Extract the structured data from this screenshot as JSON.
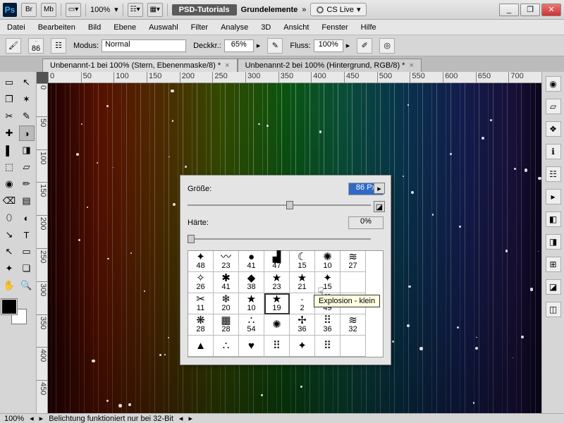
{
  "titlebar": {
    "zoom": "100%",
    "tutorials": "PSD-Tutorials",
    "workspace_name": "Grundelemente",
    "cs_live": "CS Live"
  },
  "window_controls": {
    "min": "_",
    "max": "❐",
    "close": "✕"
  },
  "menubar": [
    "Datei",
    "Bearbeiten",
    "Bild",
    "Ebene",
    "Auswahl",
    "Filter",
    "Analyse",
    "3D",
    "Ansicht",
    "Fenster",
    "Hilfe"
  ],
  "optionsbar": {
    "brush_size": "86",
    "mode_label": "Modus:",
    "mode_value": "Normal",
    "opacity_label": "Deckkr.:",
    "opacity_value": "65%",
    "flow_label": "Fluss:",
    "flow_value": "100%"
  },
  "doctabs": [
    "Unbenannt-1 bei 100% (Stern, Ebenenmaske/8) *",
    "Unbenannt-2 bei 100% (Hintergrund, RGB/8) *"
  ],
  "ruler_h": [
    "0",
    "50",
    "100",
    "150",
    "200",
    "250",
    "300",
    "350",
    "400",
    "450",
    "500",
    "550",
    "600",
    "650",
    "700"
  ],
  "ruler_v": [
    "0",
    "50",
    "100",
    "150",
    "200",
    "250",
    "300",
    "350",
    "400",
    "450"
  ],
  "brush_popup": {
    "size_label": "Größe:",
    "size_value": "86 Px",
    "hardness_label": "Härte:",
    "hardness_value": "0%",
    "flyout": "▸",
    "new_preset": "◪",
    "brushes": [
      {
        "n": "48",
        "g": "✦"
      },
      {
        "n": "23",
        "g": "〰"
      },
      {
        "n": "41",
        "g": "●"
      },
      {
        "n": "47",
        "g": "▟"
      },
      {
        "n": "15",
        "g": "☾"
      },
      {
        "n": "10",
        "g": "✺"
      },
      {
        "n": "27",
        "g": "≋"
      },
      {
        "n": "26",
        "g": "✧"
      },
      {
        "n": "41",
        "g": "✱"
      },
      {
        "n": "38",
        "g": "◆"
      },
      {
        "n": "23",
        "g": "★"
      },
      {
        "n": "21",
        "g": "★"
      },
      {
        "n": "15",
        "g": "✦"
      },
      {
        "n": "",
        "g": ""
      },
      {
        "n": "11",
        "g": "✂"
      },
      {
        "n": "20",
        "g": "❄"
      },
      {
        "n": "10",
        "g": "★"
      },
      {
        "n": "19",
        "g": "★"
      },
      {
        "n": "2",
        "g": "·"
      },
      {
        "n": "49",
        "g": "⠿"
      },
      {
        "n": "",
        "g": ""
      },
      {
        "n": "28",
        "g": "❋"
      },
      {
        "n": "28",
        "g": "▦"
      },
      {
        "n": "54",
        "g": "∴"
      },
      {
        "n": "",
        "g": "✺"
      },
      {
        "n": "36",
        "g": "✢"
      },
      {
        "n": "36",
        "g": "⠿"
      },
      {
        "n": "32",
        "g": "≋"
      },
      {
        "n": "",
        "g": "▲"
      },
      {
        "n": "",
        "g": "∴"
      },
      {
        "n": "",
        "g": "♥"
      },
      {
        "n": "",
        "g": "⠿"
      },
      {
        "n": "",
        "g": "✦"
      },
      {
        "n": "",
        "g": "⠿"
      },
      {
        "n": "",
        "g": ""
      }
    ],
    "tooltip": "Explosion - klein"
  },
  "statusbar": {
    "zoom": "100%",
    "msg": "Belichtung funktioniert nur bei 32-Bit"
  },
  "tool_glyphs": [
    "▭",
    "↖",
    "❐",
    "✶",
    "✂",
    "✎",
    "✚",
    "◑",
    "▌",
    "◨",
    "⬚",
    "▱",
    "◉",
    "✏",
    "⌫",
    "▤",
    "⬯",
    "◐",
    "↘",
    "T",
    "↖",
    "▭",
    "✦",
    "❏",
    "✋",
    "🔍"
  ],
  "rpanel_glyphs": [
    "◉",
    "▱",
    "❖",
    "ℹ",
    "☷",
    "▸",
    "◧",
    "◨",
    "⊞",
    "◪",
    "◫"
  ]
}
